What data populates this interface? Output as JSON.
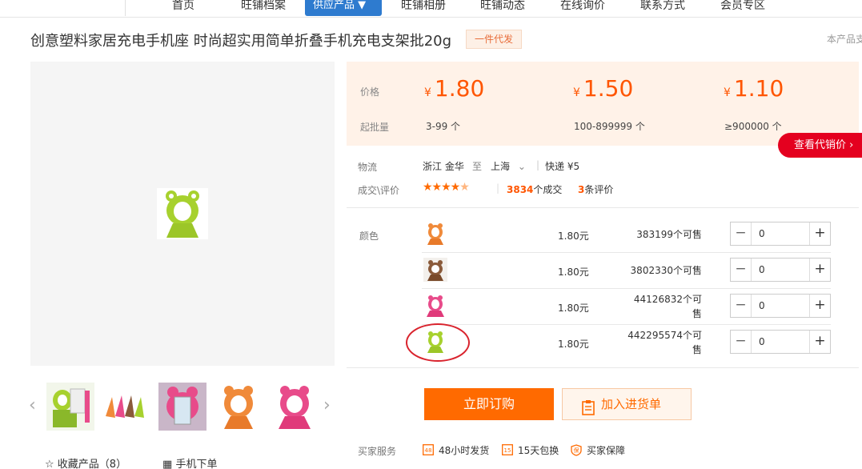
{
  "nav": {
    "items": [
      "首页",
      "旺铺档案",
      "供应产品 ▼",
      "旺铺相册",
      "旺铺动态",
      "在线询价",
      "联系方式",
      "会员专区"
    ]
  },
  "product": {
    "title": "创意塑料家居充电手机座 时尚超实用简单折叠手机充电支架批20g",
    "badge": "一件代发",
    "right_note": "本产品支"
  },
  "price_panel": {
    "price_label": "价格",
    "qty_label": "起批量",
    "currency": "¥",
    "tiers": [
      {
        "price": "1.80",
        "qty": "3-99 个"
      },
      {
        "price": "1.50",
        "qty": "100-899999 个"
      },
      {
        "price": "1.10",
        "qty": "≥900000 个"
      }
    ],
    "proxy_button": "查看代销价 ›"
  },
  "logistics": {
    "label": "物流",
    "from": "浙江 金华",
    "to_word": "至",
    "to": "上海",
    "method": "快递 ¥5"
  },
  "deals": {
    "label": "成交\\评价",
    "rating": 4.5,
    "count": "3834",
    "count_suffix": "个成交",
    "reviews": "3",
    "reviews_suffix": "条评价"
  },
  "sku": {
    "label": "颜色",
    "rows": [
      {
        "color": "orange",
        "price": "1.80元",
        "stock_line1": "383199个可售",
        "stock_line2": "",
        "qty": "0"
      },
      {
        "color": "brown",
        "price": "1.80元",
        "stock_line1": "3802330个可售",
        "stock_line2": "",
        "qty": "0"
      },
      {
        "color": "pink",
        "price": "1.80元",
        "stock_line1": "44126832个可",
        "stock_line2": "售",
        "qty": "0"
      },
      {
        "color": "green",
        "price": "1.80元",
        "stock_line1": "442295574个可",
        "stock_line2": "售",
        "qty": "0"
      }
    ]
  },
  "actions": {
    "buy": "立即订购",
    "cart": "加入进货单"
  },
  "services": {
    "label": "买家服务",
    "items": [
      "48小时发货",
      "15天包换",
      "买家保障"
    ]
  },
  "bottom": {
    "favorite": "收藏产品（8）",
    "mobile_order": "手机下单"
  },
  "colors": {
    "accent": "#ff6a00",
    "price": "#ff5500",
    "nav_active": "#2e7bcf",
    "proxy_red": "#e4001f",
    "price_bg": "#fff2e8"
  }
}
